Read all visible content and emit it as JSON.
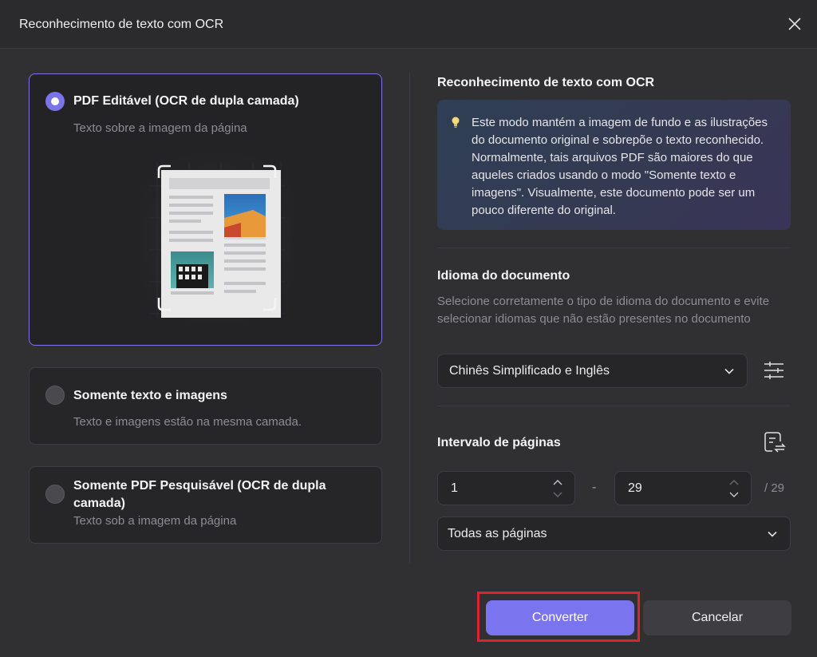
{
  "dialog": {
    "title": "Reconhecimento de texto com OCR"
  },
  "options": [
    {
      "title": "PDF Editável (OCR de dupla camada)",
      "subtitle": "Texto sobre a imagem da página",
      "selected": true
    },
    {
      "title": "Somente texto e imagens",
      "subtitle": "Texto e imagens estão na mesma camada.",
      "selected": false
    },
    {
      "title": "Somente PDF Pesquisável (OCR de dupla camada)",
      "subtitle": "Texto sob a imagem da página",
      "selected": false
    }
  ],
  "info": {
    "title": "Reconhecimento de texto com OCR",
    "text": "Este modo mantém a imagem de fundo e as ilustrações do documento original e sobrepõe o texto reconhecido. Normalmente, tais arquivos PDF são maiores do que aqueles criados usando o modo \"Somente texto e imagens\". Visualmente, este documento pode ser um pouco diferente do original."
  },
  "language": {
    "title": "Idioma do documento",
    "description": "Selecione corretamente o tipo de idioma do documento e evite selecionar idiomas que não estão presentes no documento",
    "selected": "Chinês Simplificado e Inglês"
  },
  "page_range": {
    "title": "Intervalo de páginas",
    "from": "1",
    "to": "29",
    "separator": "-",
    "total": "/ 29",
    "preset": "Todas as páginas"
  },
  "buttons": {
    "convert": "Converter",
    "cancel": "Cancelar"
  },
  "colors": {
    "accent": "#7b74ef",
    "highlight": "#d9262c"
  }
}
